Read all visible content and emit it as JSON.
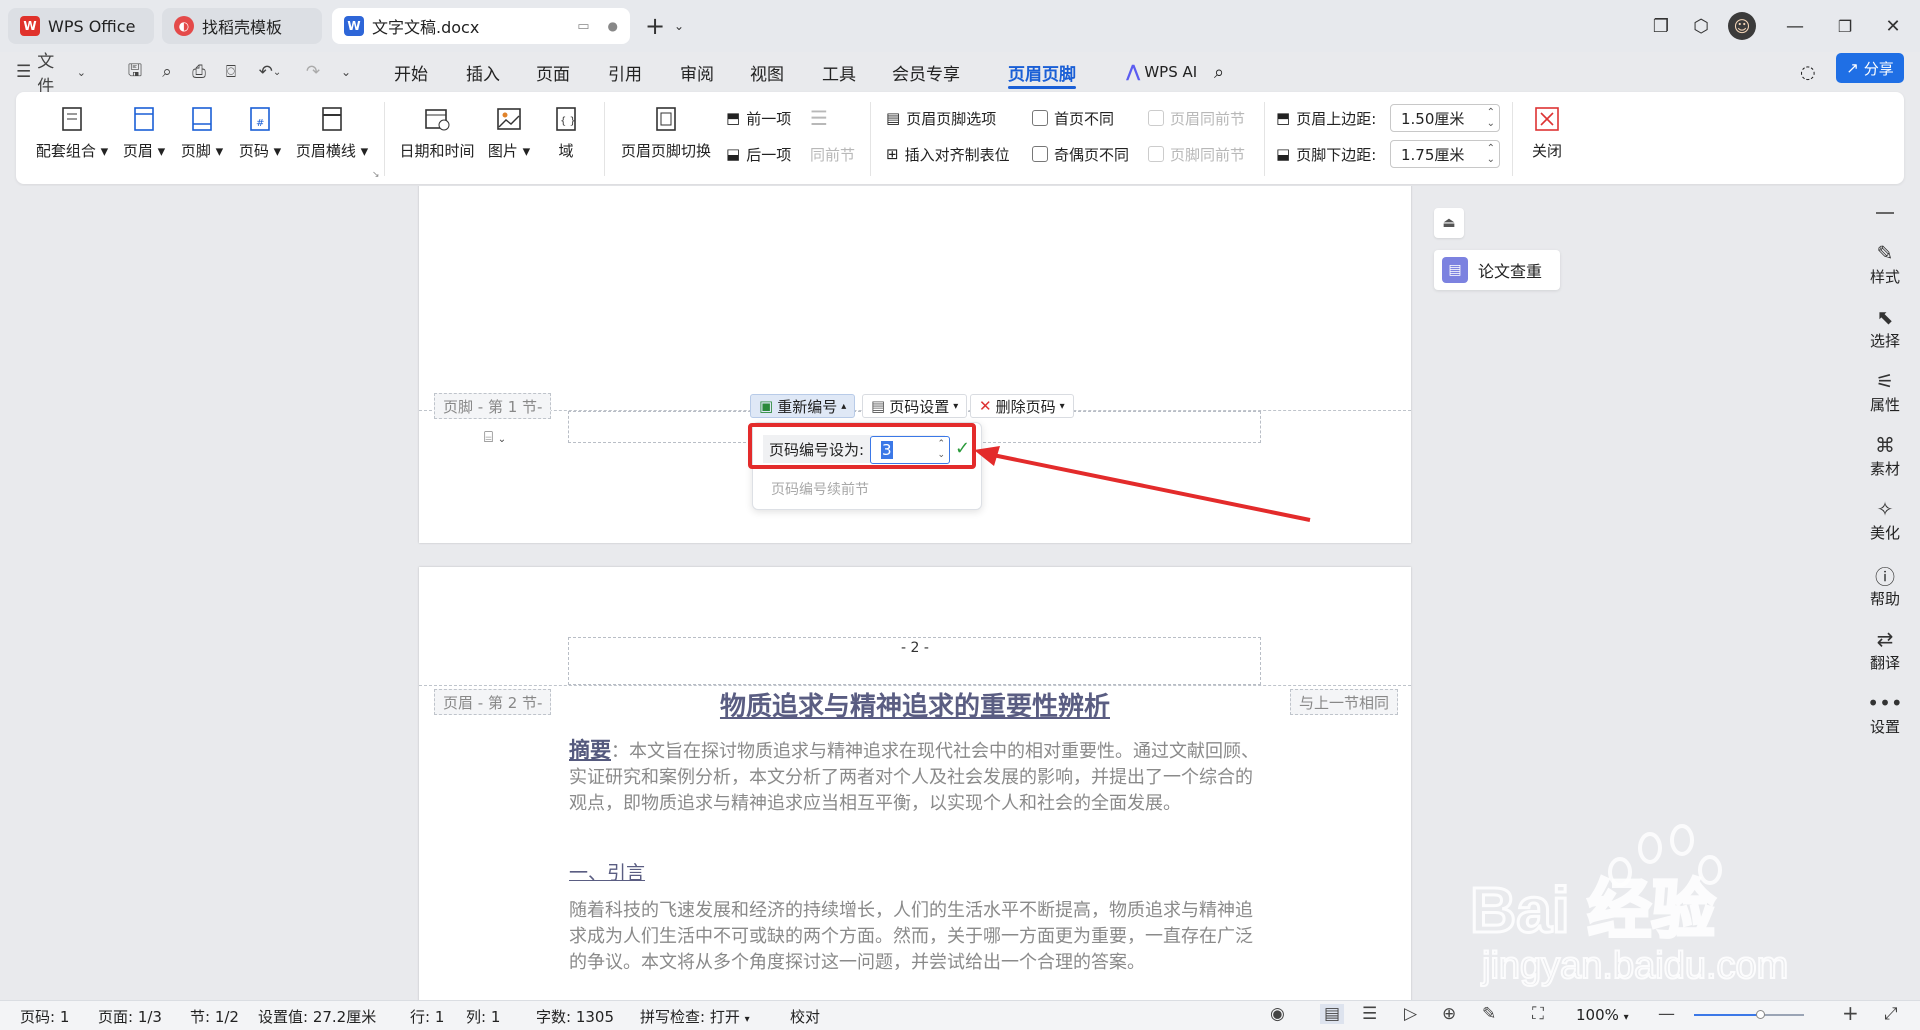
{
  "tabs": [
    {
      "label": "WPS Office",
      "icon": "wps-logo-icon"
    },
    {
      "label": "找稻壳模板",
      "icon": "docer-icon"
    },
    {
      "label": "文字文稿.docx",
      "icon": "word-doc-icon"
    }
  ],
  "menu": {
    "file": "文件",
    "items": [
      "开始",
      "插入",
      "页面",
      "引用",
      "审阅",
      "视图",
      "工具",
      "会员专享",
      "页眉页脚"
    ],
    "active": "页眉页脚",
    "wps_ai": "WPS AI",
    "share": "分享"
  },
  "ribbon": {
    "combo": "配套组合",
    "header": "页眉",
    "footer": "页脚",
    "page_num": "页码",
    "header_line": "页眉横线",
    "date_time": "日期和时间",
    "picture": "图片",
    "field": "域",
    "switch": "页眉页脚切换",
    "prev": "前一项",
    "next": "后一项",
    "same_prev": "同前节",
    "options": "页眉页脚选项",
    "insert_tab": "插入对齐制表位",
    "first_diff": "首页不同",
    "odd_even_diff": "奇偶页不同",
    "header_same_prev": "页眉同前节",
    "footer_same_prev": "页脚同前节",
    "header_top_label": "页眉上边距:",
    "header_top_value": "1.50厘米",
    "footer_bottom_label": "页脚下边距:",
    "footer_bottom_value": "1.75厘米",
    "close": "关闭"
  },
  "doc": {
    "footer_tag": "页脚 - 第 1 节-",
    "renumber": "重新编号",
    "page_setup": "页码设置",
    "delete_page_num": "删除页码",
    "popup_label": "页码编号设为:",
    "popup_value": "3",
    "popup_continue": "页码编号续前节",
    "page2_number": "- 2 -",
    "header_tag": "页眉 - 第 2 节-",
    "same_as_prev": "与上一节相同",
    "title": "物质追求与精神追求的重要性辨析",
    "abstract_label": "摘要",
    "abstract": "：本文旨在探讨物质追求与精神追求在现代社会中的相对重要性。通过文献回顾、实证研究和案例分析，本文分析了两者对个人及社会发展的影响，并提出了一个综合的观点，即物质追求与精神追求应当相互平衡，以实现个人和社会的全面发展。",
    "section1": "一、引言",
    "intro": "随着科技的飞速发展和经济的持续增长，人们的生活水平不断提高，物质追求与精神追求成为人们生活中不可或缺的两个方面。然而，关于哪一方面更为重要，一直存在广泛的争议。本文将从多个角度探讨这一问题，并尝试给出一个合理的答案。"
  },
  "side": {
    "plagiarism": "论文查重",
    "items": [
      "样式",
      "选择",
      "属性",
      "素材",
      "美化",
      "帮助",
      "翻译",
      "设置"
    ]
  },
  "status": {
    "page_code": "页码: 1",
    "page": "页面: 1/3",
    "section": "节: 1/2",
    "setting": "设置值: 27.2厘米",
    "row": "行: 1",
    "col": "列: 1",
    "words": "字数: 1305",
    "spell": "拼写检查: 打开",
    "proof": "校对",
    "zoom": "100%",
    "zoom_level": 0.6
  },
  "watermark": {
    "brand": "Bai  经验",
    "url": "jingyan.baidu.com"
  },
  "colors": {
    "accent": "#1a5fd6",
    "highlight": "#e32b2b",
    "share": "#1f6fe5"
  }
}
